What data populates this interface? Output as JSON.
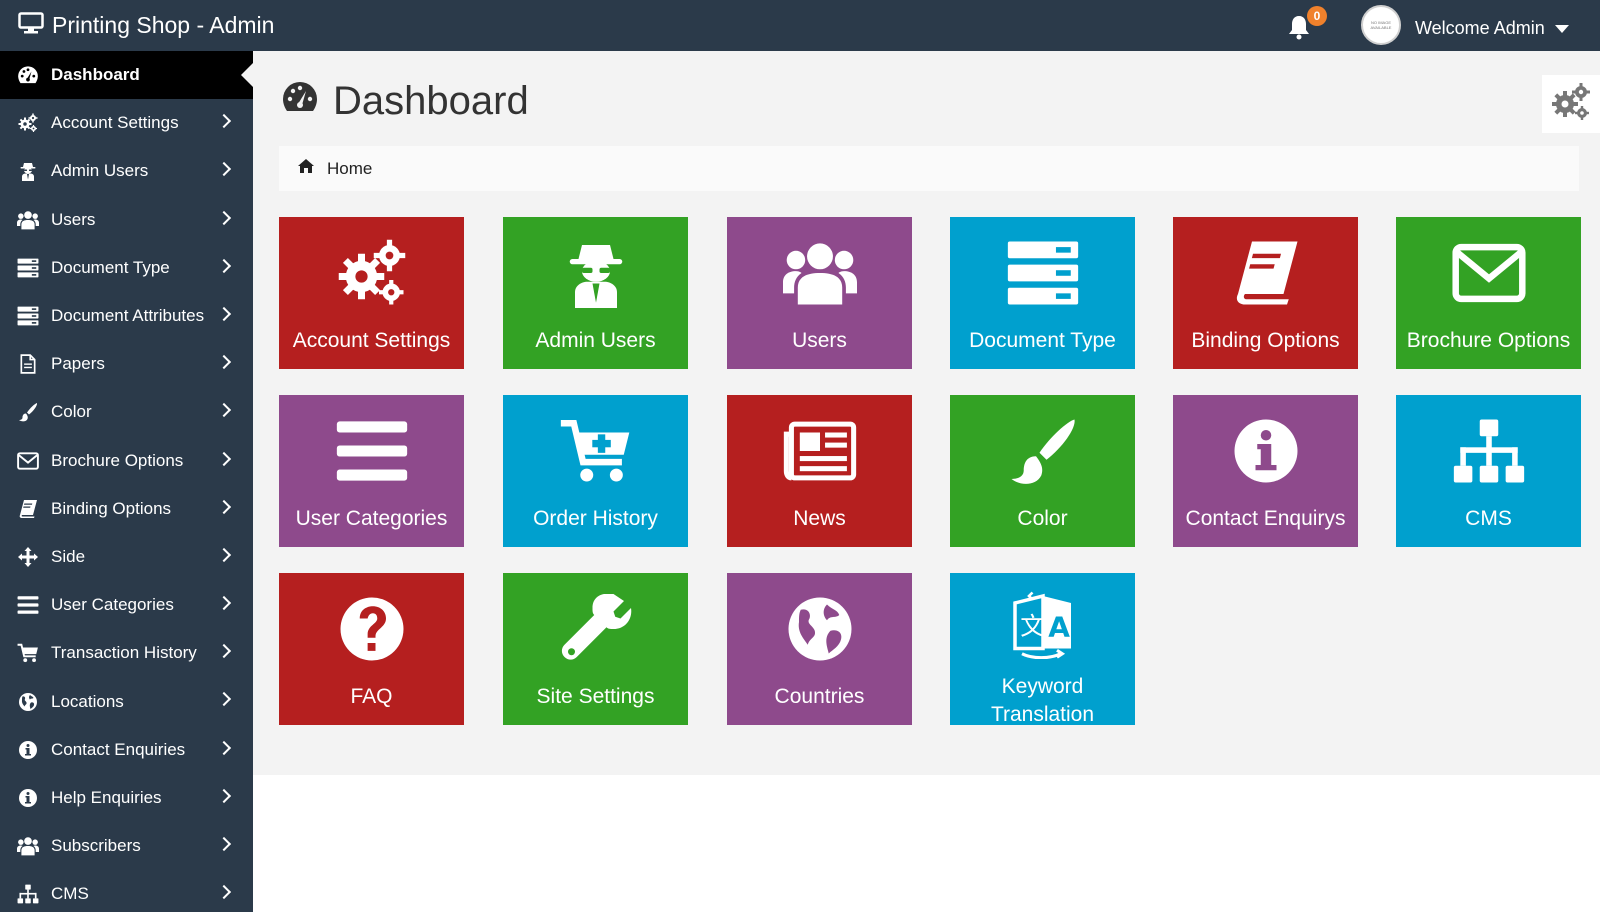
{
  "header": {
    "brand": "Printing Shop - Admin",
    "notifications_count": "0",
    "avatar_text": "NO IMAGE AVAILABLE",
    "welcome": "Welcome Admin"
  },
  "sidebar": {
    "items": [
      {
        "label": "Dashboard",
        "icon": "dashboard-icon",
        "active": true
      },
      {
        "label": "Account Settings",
        "icon": "gears-icon"
      },
      {
        "label": "Admin Users",
        "icon": "user-secret-icon"
      },
      {
        "label": "Users",
        "icon": "users-icon"
      },
      {
        "label": "Document Type",
        "icon": "server-icon"
      },
      {
        "label": "Document Attributes",
        "icon": "server-icon"
      },
      {
        "label": "Papers",
        "icon": "file-icon"
      },
      {
        "label": "Color",
        "icon": "paint-brush-icon"
      },
      {
        "label": "Brochure Options",
        "icon": "envelope-icon"
      },
      {
        "label": "Binding Options",
        "icon": "book-icon"
      },
      {
        "label": "Side",
        "icon": "arrows-icon"
      },
      {
        "label": "User Categories",
        "icon": "bars-icon"
      },
      {
        "label": "Transaction History",
        "icon": "cart-icon"
      },
      {
        "label": "Locations",
        "icon": "globe-icon"
      },
      {
        "label": "Contact Enquiries",
        "icon": "info-icon"
      },
      {
        "label": "Help Enquiries",
        "icon": "info-icon"
      },
      {
        "label": "Subscribers",
        "icon": "users-icon"
      },
      {
        "label": "CMS",
        "icon": "sitemap-icon"
      }
    ]
  },
  "main": {
    "title": "Dashboard",
    "breadcrumb": "Home"
  },
  "tiles": [
    {
      "label": "Account Settings",
      "icon": "gears-icon",
      "color": "#b51f1f"
    },
    {
      "label": "Admin Users",
      "icon": "user-secret-icon",
      "color": "#33a224"
    },
    {
      "label": "Users",
      "icon": "users-icon",
      "color": "#8e4a8c"
    },
    {
      "label": "Document Type",
      "icon": "server-icon",
      "color": "#00a0ce"
    },
    {
      "label": "Binding Options",
      "icon": "book-icon",
      "color": "#b51f1f"
    },
    {
      "label": "Brochure Options",
      "icon": "envelope-icon",
      "color": "#33a224"
    },
    {
      "label": "User Categories",
      "icon": "bars-icon",
      "color": "#8e4a8c"
    },
    {
      "label": "Order History",
      "icon": "cart-plus-icon",
      "color": "#00a0ce"
    },
    {
      "label": "News",
      "icon": "newspaper-icon",
      "color": "#b51f1f"
    },
    {
      "label": "Color",
      "icon": "paint-brush-icon",
      "color": "#33a224"
    },
    {
      "label": "Contact Enquirys",
      "icon": "info-icon",
      "color": "#8e4a8c"
    },
    {
      "label": "CMS",
      "icon": "sitemap-icon",
      "color": "#00a0ce"
    },
    {
      "label": "FAQ",
      "icon": "question-icon",
      "color": "#b51f1f"
    },
    {
      "label": "Site Settings",
      "icon": "wrench-icon",
      "color": "#33a224"
    },
    {
      "label": "Countries",
      "icon": "globe-icon",
      "color": "#8e4a8c"
    },
    {
      "label": "Keyword Translation",
      "icon": "translate-icon",
      "color": "#00a0ce"
    }
  ]
}
